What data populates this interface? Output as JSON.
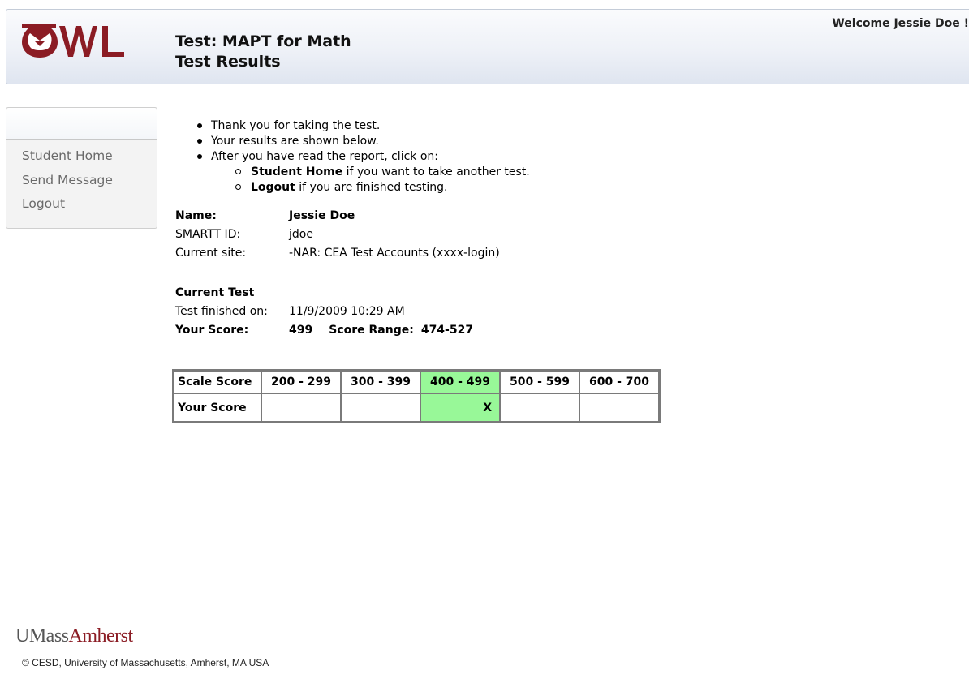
{
  "header": {
    "logo_text": "OWL",
    "title_line1": "Test: MAPT for Math",
    "title_line2": "Test Results",
    "welcome": "Welcome Jessie Doe !"
  },
  "sidebar": {
    "items": [
      {
        "label": "Student Home"
      },
      {
        "label": "Send Message"
      },
      {
        "label": "Logout"
      }
    ]
  },
  "instructions": {
    "bullets": [
      "Thank you for taking the test.",
      "Your results are shown below.",
      "After you have read the report, click on:"
    ],
    "sub_items": [
      {
        "bold": "Student Home",
        "text": " if you want to take another test."
      },
      {
        "bold": "Logout",
        "text": " if you are finished testing."
      }
    ]
  },
  "student": {
    "name_label": "Name:",
    "name": "Jessie Doe",
    "id_label": "SMARTT ID:",
    "id": "jdoe",
    "site_label": "Current site:",
    "site": "-NAR: CEA Test Accounts (xxxx-login)"
  },
  "current_test": {
    "heading": "Current Test",
    "finished_label": "Test finished on:",
    "finished": "11/9/2009 10:29 AM",
    "score_label": "Your Score:",
    "score": "499",
    "range_label": "Score Range:",
    "range": "474-527"
  },
  "score_table": {
    "row1_label": "Scale Score",
    "row2_label": "Your Score",
    "ranges": [
      "200 - 299",
      "300 - 399",
      "400 - 499",
      "500 - 599",
      "600 - 700"
    ],
    "marks": [
      "",
      "",
      "X",
      "",
      ""
    ],
    "highlight_index": 2,
    "highlight_color": "#98f898"
  },
  "footer": {
    "logo_part1": "UMass",
    "logo_part2": "Amherst",
    "copyright": "© CESD, University of Massachusetts, Amherst, MA USA"
  },
  "colors": {
    "brand_red": "#8b1c24",
    "sidebar_text": "#6a6a6a"
  }
}
